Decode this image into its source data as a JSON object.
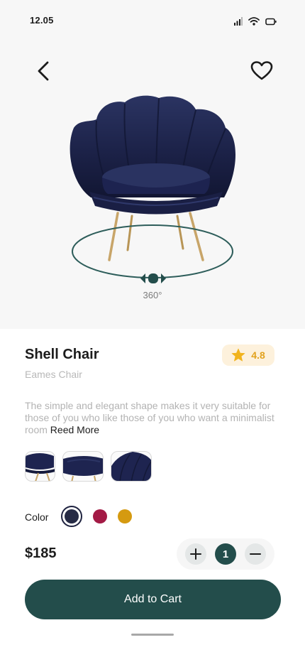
{
  "status_bar": {
    "time": "12.05"
  },
  "product": {
    "name": "Shell Chair",
    "brand": "Eames Chair",
    "rating": "4.8",
    "description": "The simple and elegant shape makes it very suitable for those of you who like those of you who want a minimalist room",
    "read_more_label": "Reed More",
    "rotation_label": "360°",
    "price": "$185"
  },
  "color": {
    "label": "Color",
    "options": [
      "#262b45",
      "#a31a45",
      "#d59a10"
    ],
    "selected": "#262b45"
  },
  "quantity": {
    "value": "1"
  },
  "cart": {
    "button_label": "Add to Cart"
  },
  "theme": {
    "accent": "#234d4b",
    "rating_star": "#f1b31d",
    "rating_bg": "#fdf1dc"
  },
  "icons": [
    "back-icon",
    "heart-icon",
    "signal-icon",
    "wifi-icon",
    "battery-icon",
    "star-icon",
    "plus-icon",
    "minus-icon"
  ]
}
